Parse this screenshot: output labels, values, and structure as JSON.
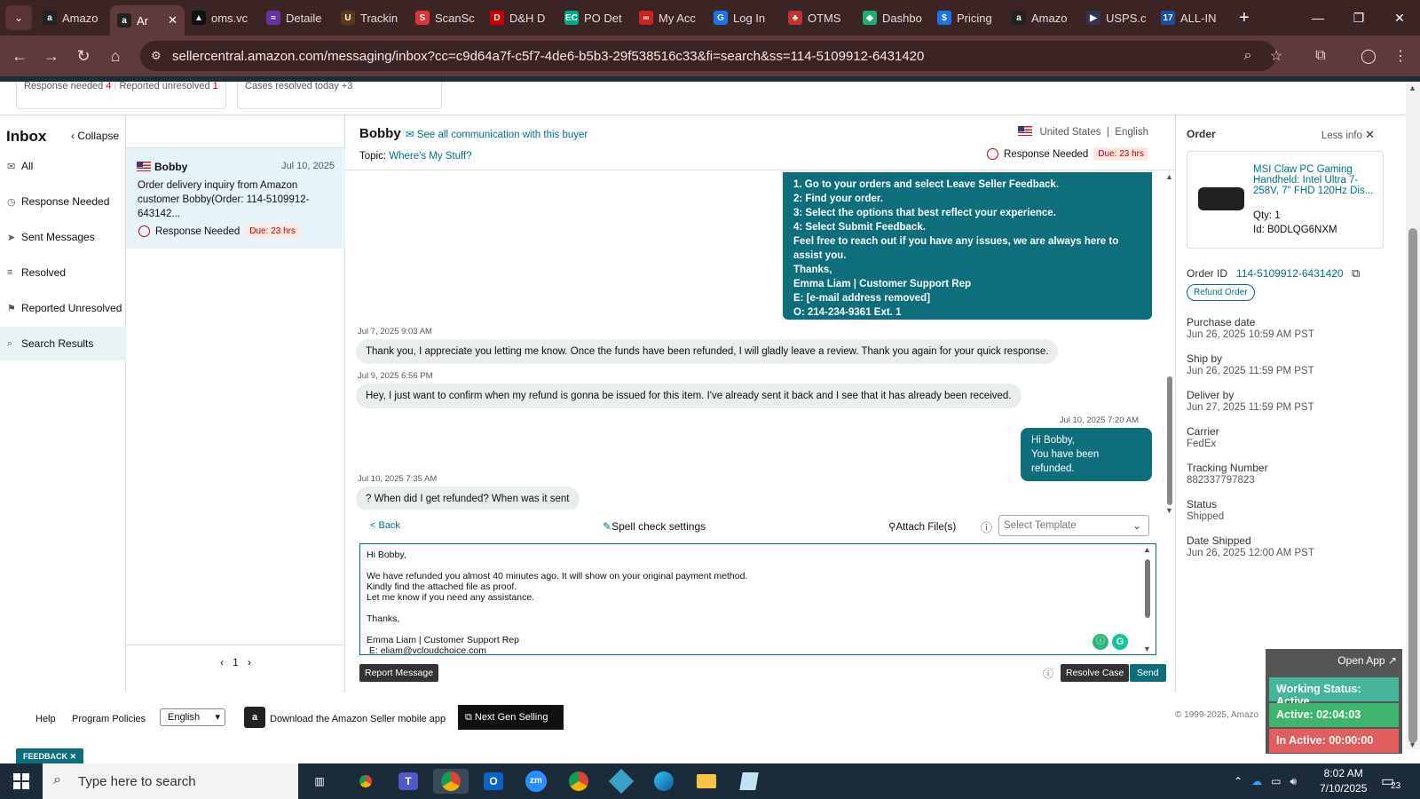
{
  "browser": {
    "tabs": [
      {
        "label": "Amazo",
        "fav": "a",
        "color": "#222"
      },
      {
        "label": "Ar",
        "fav": "a",
        "color": "#222",
        "active": true
      },
      {
        "label": "oms.vc",
        "fav": "▲",
        "color": "#111"
      },
      {
        "label": "Detaile",
        "fav": "≈",
        "color": "#6b2fa0"
      },
      {
        "label": "Trackin",
        "fav": "U",
        "color": "#5a3a1a"
      },
      {
        "label": "ScanSc",
        "fav": "S",
        "color": "#d33"
      },
      {
        "label": "D&H D",
        "fav": "D",
        "color": "#c00"
      },
      {
        "label": "PO Det",
        "fav": "EC",
        "color": "#0a8"
      },
      {
        "label": "My Acc",
        "fav": "∞",
        "color": "#c22"
      },
      {
        "label": "Log In",
        "fav": "G",
        "color": "#1a73e8"
      },
      {
        "label": "OTMS",
        "fav": "♣",
        "color": "#b33"
      },
      {
        "label": "Dashbo",
        "fav": "◆",
        "color": "#2a7"
      },
      {
        "label": "Pricing",
        "fav": "$",
        "color": "#1a73e8"
      },
      {
        "label": "Amazo",
        "fav": "a",
        "color": "#222"
      },
      {
        "label": "USPS.c",
        "fav": "▶",
        "color": "#335"
      },
      {
        "label": "ALL-IN",
        "fav": "17",
        "color": "#1a4fa0"
      }
    ],
    "url": "sellercentral.amazon.com/messaging/inbox?cc=c9d64a7f-c5f7-4de6-b5b3-29f538516c33&fi=search&ss=114-5109912-6431420"
  },
  "stats": {
    "response_needed_label": "Response needed",
    "response_needed_count": "4",
    "reported_unresolved_label": "Reported unresolved",
    "reported_unresolved_count": "1",
    "cases_resolved": "Cases resolved today +3"
  },
  "leftnav": {
    "title": "Inbox",
    "collapse": "Collapse",
    "items": [
      "All",
      "Response Needed",
      "Sent Messages",
      "Resolved",
      "Reported Unresolved",
      "Search Results"
    ]
  },
  "conversation": {
    "name": "Bobby",
    "date": "Jul 10, 2025",
    "preview": "Order delivery inquiry from Amazon customer Bobby(Order: 114-5109912-643142...",
    "status": "Response Needed",
    "due": "Due: 23 hrs",
    "page": "1"
  },
  "chat": {
    "buyer": "Bobby",
    "see_all": "See all communication with this buyer",
    "topic_label": "Topic:",
    "topic": "Where's My Stuff?",
    "country": "United States",
    "language": "English",
    "response_status": "Response Needed",
    "due": "Due: 23 hrs",
    "msg1_lines": [
      "1. Go to your orders and select Leave Seller Feedback.",
      "2: Find your order.",
      "3: Select the options that best reflect your experience.",
      "4: Select Submit Feedback.",
      "Feel free to reach out if you have any issues, we are always here to assist you.",
      "Thanks,",
      "Emma Liam | Customer Support Rep",
      " E: [e-mail address removed]",
      "O: 214-234-9361 Ext. 1",
      "---"
    ],
    "msg2_time": "Jul 7, 2025 9:03 AM",
    "msg2": "Thank you, I appreciate you letting me know. Once the funds have been refunded, I will gladly leave a review. Thank you again for your quick response.",
    "msg3_time": "Jul 9, 2025 6:56 PM",
    "msg3": "Hey, I just want to confirm when my refund is gonna be issued for this item. I've already sent it back and I see that it has already been received.",
    "msg4_time": "Jul 10, 2025 7:20 AM",
    "msg4_l1": "Hi Bobby,",
    "msg4_l2": "You have been refunded.",
    "msg5_time": "Jul 10, 2025 7:35 AM",
    "msg5": "? When did I get refunded? When was it sent"
  },
  "composer": {
    "back": "< Back",
    "spell": "Spell check settings",
    "attach": "Attach File(s)",
    "template_placeholder": "Select Template",
    "body": "Hi Bobby,\n\nWe have refunded you almost 40 minutes ago. It will show on your original payment method.\nKindly find the attached file as proof.\nLet me know if you need any assistance.\n\nThanks,\n\nEmma Liam | Customer Support Rep\n E: eliam@vcloudchoice.com",
    "report": "Report Message",
    "resolve": "Resolve Case",
    "send": "Send"
  },
  "order": {
    "header": "Order",
    "less_info": "Less info",
    "product": "MSI Claw PC Gaming Handheld: Intel Ultra 7-258V, 7\" FHD 120Hz Dis...",
    "qty": "Qty: 1",
    "id": "Id: B0DLQG6NXM",
    "order_id_label": "Order ID",
    "order_id": "114-5109912-6431420",
    "refund": "Refund Order",
    "fields": [
      {
        "label": "Purchase date",
        "value": "Jun 26, 2025 10:59 AM PST"
      },
      {
        "label": "Ship by",
        "value": "Jun 26, 2025 11:59 PM PST"
      },
      {
        "label": "Deliver by",
        "value": "Jun 27, 2025 11:59 PM PST"
      },
      {
        "label": "Carrier",
        "value": "FedEx"
      },
      {
        "label": "Tracking Number",
        "value": "882337797823"
      },
      {
        "label": "Status",
        "value": "Shipped"
      },
      {
        "label": "Date Shipped",
        "value": "Jun 26, 2025 12:00 AM PST"
      }
    ]
  },
  "footer": {
    "help": "Help",
    "policies": "Program Policies",
    "language": "English",
    "mobile": "Download the Amazon Seller mobile app",
    "nextgen": "Next Gen Selling",
    "copyright": "© 1999-2025, Amazo",
    "feedback": "FEEDBACK"
  },
  "widget": {
    "open_app": "Open App ↗",
    "working": "Working Status: Active",
    "active": "Active: 02:04:03",
    "inactive": "In Active: 00:00:00"
  },
  "taskbar": {
    "search_placeholder": "Type here to search",
    "time": "8:02 AM",
    "date": "7/10/2025",
    "notif": "23"
  }
}
